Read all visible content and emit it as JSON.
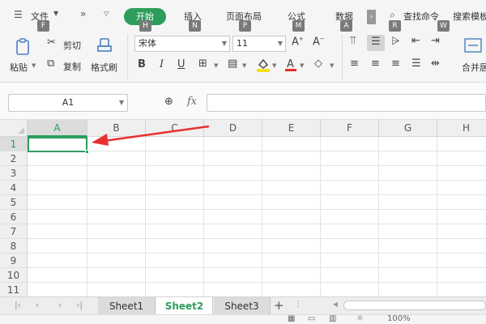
{
  "menu": {
    "file": "文件",
    "start": "开始",
    "insert": "插入",
    "page_layout": "页面布局",
    "formula": "公式",
    "data": "数据",
    "search": "查找命令",
    "search_template": "搜索模板"
  },
  "keytips": {
    "file": "F",
    "start": "H",
    "insert": "N",
    "page_layout": "P",
    "formula": "M",
    "data": "A",
    "review": "R",
    "view": "W"
  },
  "ribbon": {
    "paste": "粘贴",
    "cut": "剪切",
    "copy": "复制",
    "format_painter": "格式刷",
    "font_name": "宋体",
    "font_size": "11",
    "merge_center": "合并居"
  },
  "name_box": "A1",
  "fx_label": "fx",
  "formula_value": "",
  "columns": [
    "A",
    "B",
    "C",
    "D",
    "E",
    "F",
    "G",
    "H"
  ],
  "rows": [
    "1",
    "2",
    "3",
    "4",
    "5",
    "6",
    "7",
    "8",
    "9",
    "10",
    "11"
  ],
  "active_cell": "A1",
  "sheets": [
    "Sheet1",
    "Sheet2",
    "Sheet3"
  ],
  "active_sheet": "Sheet2",
  "add_sheet": "+",
  "status": {
    "zoom": "100%"
  },
  "colors": {
    "accent": "#2d9d5c",
    "annotation_arrow": "#e83030"
  }
}
